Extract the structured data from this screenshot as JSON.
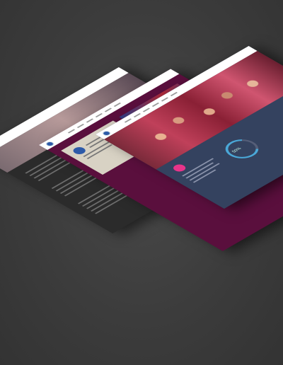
{
  "mockup": {
    "front_page": {
      "stat_percentage": "50%"
    }
  },
  "colors": {
    "background": "#3c3c3c",
    "gallery_page": "#5a0f3d",
    "stats_panel": "#2e3a55",
    "accent_pink": "#e8348a",
    "ring_blue": "#4aa8d8"
  }
}
